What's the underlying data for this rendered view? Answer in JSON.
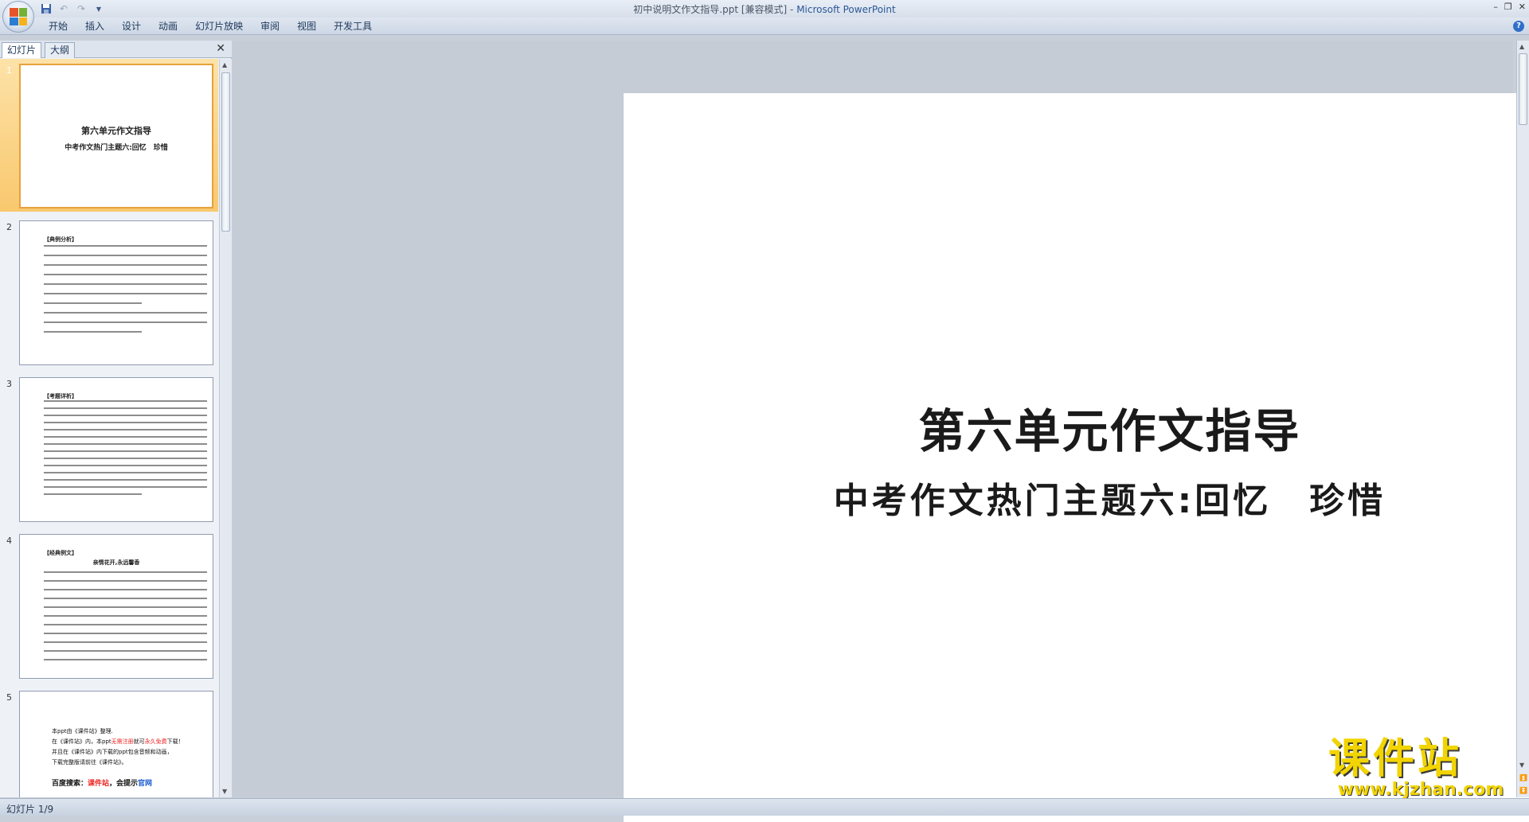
{
  "window": {
    "doc_title": "初中说明文作文指导.ppt [兼容模式]",
    "separator": " - ",
    "app_name": "Microsoft PowerPoint"
  },
  "qat": {
    "save_icon": "save-icon",
    "undo_icon": "undo-icon",
    "redo_icon": "redo-icon",
    "customize_icon": "chevron-down-icon"
  },
  "ribbon": {
    "tabs": [
      "开始",
      "插入",
      "设计",
      "动画",
      "幻灯片放映",
      "审阅",
      "视图",
      "开发工具"
    ],
    "help_label": "?"
  },
  "pane": {
    "tab_slides": "幻灯片",
    "tab_outline": "大纲",
    "close_label": "✕"
  },
  "thumbnails": [
    {
      "number": "1",
      "title": "第六单元作文指导",
      "subtitle": "中考作文热门主题六:回忆　珍惜"
    },
    {
      "number": "2",
      "heading": "【典例分析】"
    },
    {
      "number": "3",
      "heading": "【考题详析】"
    },
    {
      "number": "4",
      "heading": "【经典例文】",
      "center": "亲情花开,永远馨香"
    },
    {
      "number": "5",
      "line1": "本ppt由《课件站》整理.",
      "line2a": "在《课件站》内，本ppt",
      "line2b": "无需注册",
      "line2c": "就可",
      "line2d": "永久免费",
      "line2e": "下载！",
      "line3": "并且在《课件站》内下载的ppt包含音频和动画，",
      "line4": "下载完整版请前往《课件站》。",
      "search_label": "百度搜索：",
      "search_term": "课件站",
      "search_hint": "，会提示",
      "search_link": "官网"
    }
  ],
  "slide": {
    "title": "第六单元作文指导",
    "subtitle": "中考作文热门主题六:回忆　珍惜"
  },
  "watermark": {
    "cn": "课件站",
    "url": "www.kjzhan.com"
  },
  "status": {
    "slide_indicator": "幻灯片 1/9"
  }
}
